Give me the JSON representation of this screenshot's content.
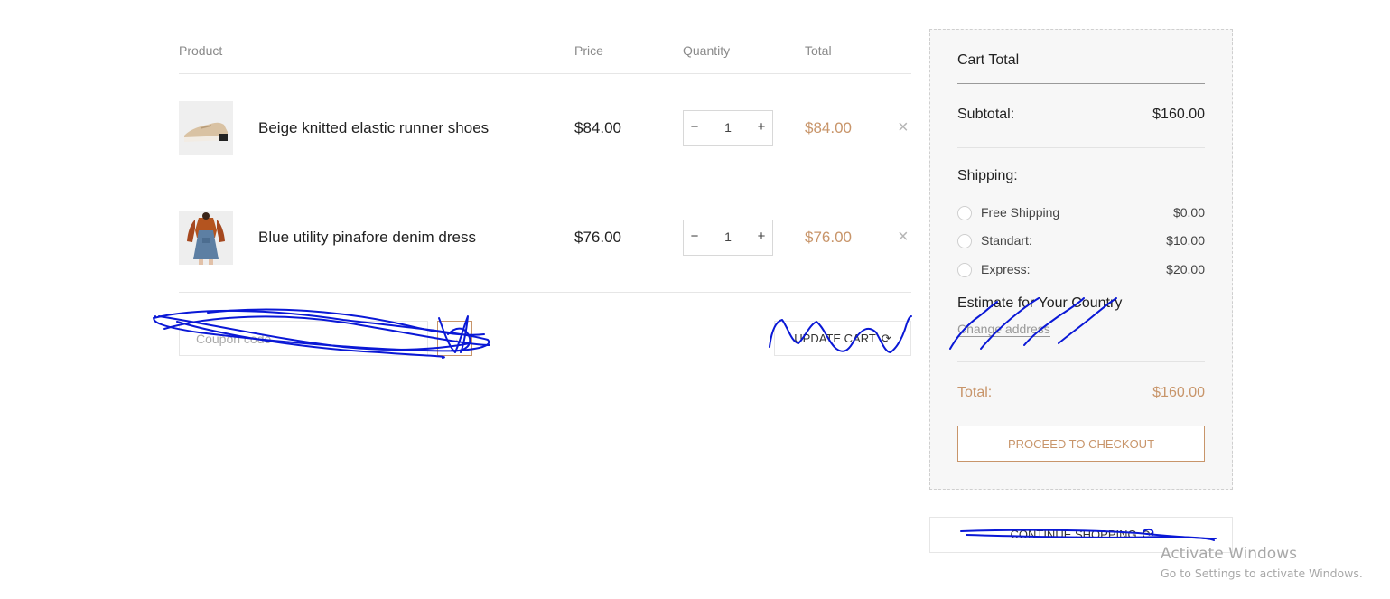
{
  "table": {
    "headers": {
      "product": "Product",
      "price": "Price",
      "quantity": "Quantity",
      "total": "Total"
    },
    "rows": [
      {
        "name": "Beige knitted elastic runner shoes",
        "price": "$84.00",
        "qty": "1",
        "total": "$84.00",
        "image": "beige-shoe-thumbnail"
      },
      {
        "name": "Blue utility pinafore denim dress",
        "price": "$76.00",
        "qty": "1",
        "total": "$76.00",
        "image": "denim-dress-thumbnail"
      }
    ],
    "qty_minus": "−",
    "qty_plus": "+",
    "remove_icon": "×"
  },
  "coupon": {
    "placeholder": "Coupon code"
  },
  "update_cart": {
    "label": "UPDATE CART",
    "icon": "⟳"
  },
  "summary": {
    "title": "Cart Total",
    "subtotal_label": "Subtotal:",
    "subtotal_value": "$160.00",
    "shipping_label": "Shipping:",
    "shipping_options": [
      {
        "name": "Free Shipping",
        "price": "$0.00"
      },
      {
        "name": "Standart:",
        "price": "$10.00"
      },
      {
        "name": "Express:",
        "price": "$20.00"
      }
    ],
    "estimate_label": "Estimate for Your Country",
    "change_address": "Change address",
    "total_label": "Total:",
    "total_value": "$160.00",
    "checkout_label": "PROCEED TO CHECKOUT"
  },
  "continue_shopping": {
    "label": "CONTINUE SHOPPING",
    "icon": "⟳"
  },
  "watermark": {
    "line1": "Activate Windows",
    "line2": "Go to Settings to activate Windows."
  },
  "colors": {
    "accent": "#c8956a",
    "scribble": "#0a18d6",
    "border": "#e6e6e6",
    "panel": "#f7f7f7"
  }
}
